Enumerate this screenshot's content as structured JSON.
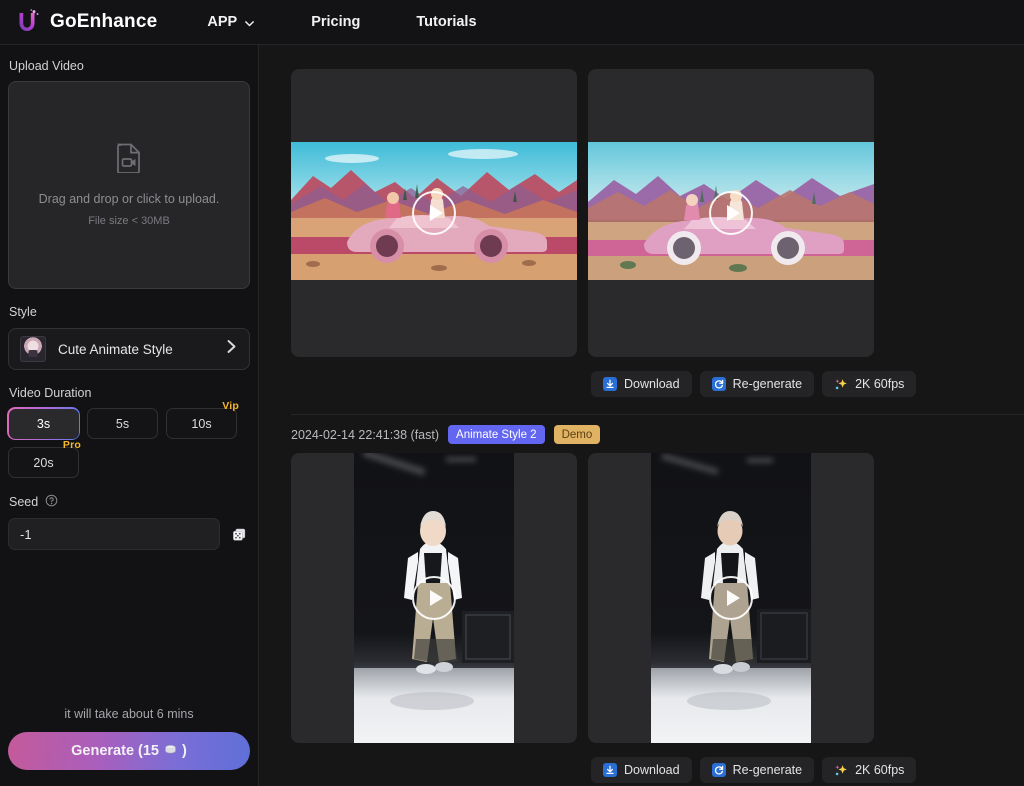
{
  "header": {
    "brand_name": "GoEnhance",
    "logo_icon": "goenhance-logo-icon",
    "nav": [
      {
        "label": "APP",
        "icon": "chevron-down-icon"
      },
      {
        "label": "Pricing",
        "icon": ""
      },
      {
        "label": "Tutorials",
        "icon": ""
      }
    ]
  },
  "sidebar": {
    "upload": {
      "label": "Upload Video",
      "icon": "video-file-icon",
      "hint": "Drag and drop or click to upload.",
      "sub": "File size < 30MB"
    },
    "style": {
      "label": "Style",
      "value": "Cute Animate Style",
      "thumb_icon": "style-thumbnail",
      "chevron": "›"
    },
    "duration": {
      "label": "Video Duration",
      "options": [
        {
          "value": "3s",
          "tag": "",
          "selected": true
        },
        {
          "value": "5s",
          "tag": "",
          "selected": false
        },
        {
          "value": "10s",
          "tag": "Vip",
          "selected": false
        },
        {
          "value": "20s",
          "tag": "Pro",
          "selected": false
        }
      ]
    },
    "seed": {
      "label": "Seed",
      "help_icon": "help-circle-icon",
      "value": "-1",
      "placeholder": "-1",
      "dice_icon": "dice-icon"
    },
    "footer": {
      "eta": "it will take about 6 mins",
      "generate_label": "Generate (15",
      "generate_suffix": ")",
      "coin_icon": "coin-icon"
    }
  },
  "main": {
    "results": [
      {
        "meta_visible": false,
        "timestamp": "",
        "badges": [],
        "videos": [
          {
            "name": "generated-video",
            "orientation": "wide",
            "play_icon": "play-icon"
          },
          {
            "name": "original-video",
            "orientation": "wide",
            "play_icon": "play-icon"
          }
        ],
        "actions": [
          {
            "label": "Download",
            "icon": "download-icon"
          },
          {
            "label": "Re-generate",
            "icon": "refresh-icon"
          },
          {
            "label": "2K 60fps",
            "icon": "sparkle-icon"
          }
        ]
      },
      {
        "meta_visible": true,
        "timestamp": "2024-02-14 22:41:38 (fast)",
        "badges": [
          {
            "text": "Animate Style 2",
            "kind": "style"
          },
          {
            "text": "Demo",
            "kind": "demo"
          }
        ],
        "videos": [
          {
            "name": "generated-video",
            "orientation": "tall",
            "play_icon": "play-icon"
          },
          {
            "name": "original-video",
            "orientation": "tall",
            "play_icon": "play-icon"
          }
        ],
        "actions": [
          {
            "label": "Download",
            "icon": "download-icon"
          },
          {
            "label": "Re-generate",
            "icon": "refresh-icon"
          },
          {
            "label": "2K 60fps",
            "icon": "sparkle-icon"
          }
        ]
      }
    ]
  },
  "colors": {
    "accent_pink": "#c45a9a",
    "accent_blue": "#5f6fd8",
    "badge_style": "#6366f1",
    "badge_demo": "#e0b263",
    "tag_gold": "#f5b82e",
    "page_bg": "#161617",
    "panel_bg": "#2a2a2c"
  }
}
